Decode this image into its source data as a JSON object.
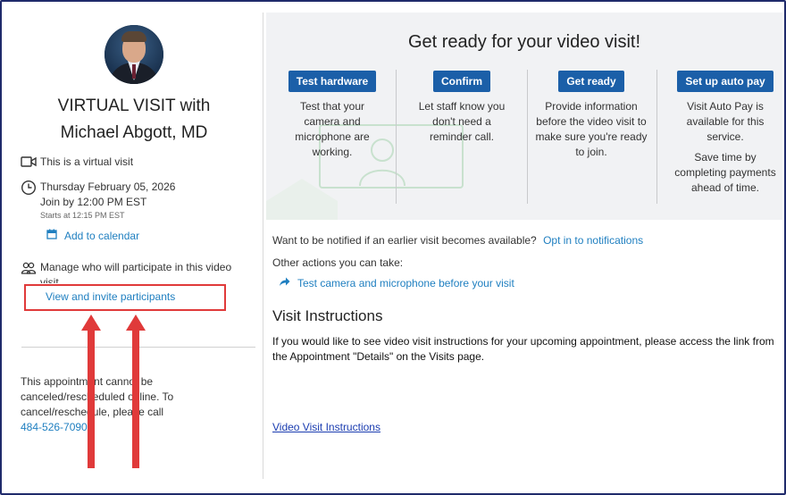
{
  "provider": {
    "title_line1": "VIRTUAL VISIT with",
    "title_line2": "Michael Abgott, MD"
  },
  "visit": {
    "type_text": "This is a virtual visit",
    "date": "Thursday February 05, 2026",
    "join_by": "Join by 12:00 PM EST",
    "starts_at": "Starts at 12:15 PM EST",
    "add_to_calendar": "Add to calendar"
  },
  "participants": {
    "manage_text": "Manage who will participate in this video visit.",
    "invite_link": "View and invite participants"
  },
  "cancel_notice": {
    "line1": "This appointment cannot be",
    "line2": "canceled/rescheduled online. To",
    "line3": "cancel/reschedule, please call",
    "phone": "484-526-7090"
  },
  "get_ready": {
    "title": "Get ready for your video visit!",
    "steps": [
      {
        "button": "Test hardware",
        "desc": "Test that your camera and microphone are working."
      },
      {
        "button": "Confirm",
        "desc": "Let staff know you don't need a reminder call."
      },
      {
        "button": "Get ready",
        "desc": "Provide information before the video visit to make sure you're ready to join."
      },
      {
        "button": "Set up auto pay",
        "desc": "Visit Auto Pay is available for this service.",
        "desc2": "Save time by completing payments ahead of time."
      }
    ]
  },
  "notify": {
    "question": "Want to be notified if an earlier visit becomes available?",
    "link": "Opt in to notifications"
  },
  "other_actions": {
    "label": "Other actions you can take:",
    "test_link": "Test camera and microphone before your visit"
  },
  "instructions": {
    "heading": "Visit Instructions",
    "text": "If you would like to see video visit instructions for your upcoming appointment, please access the link from the Appointment \"Details\" on the Visits page.",
    "link": "Video Visit Instructions"
  },
  "colors": {
    "primary_button": "#1b5fa8",
    "link": "#1f7fc0",
    "annotation": "#e03a3a"
  }
}
